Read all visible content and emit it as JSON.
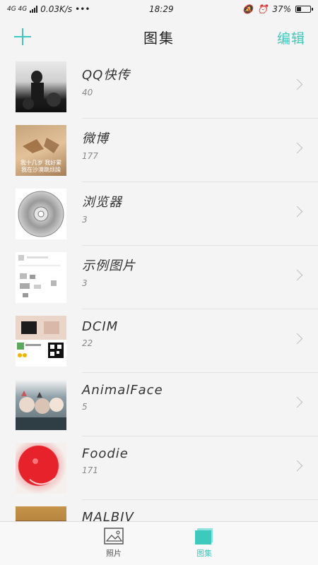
{
  "status_bar": {
    "network": "4G 4G",
    "speed": "0.03K/s",
    "dots": "•••",
    "time": "18:29",
    "battery": "37%",
    "battery_level": 0.37
  },
  "header": {
    "title": "图集",
    "edit_label": "编辑",
    "add_icon": "plus-icon",
    "accent_color": "#3ec9bd"
  },
  "albums": [
    {
      "name": "QQ快传",
      "count": "40"
    },
    {
      "name": "微博",
      "count": "177",
      "caption1": "我十几岁 我好累",
      "caption2": "我在沙漠跳烦躁"
    },
    {
      "name": "浏览器",
      "count": "3"
    },
    {
      "name": "示例图片",
      "count": "3"
    },
    {
      "name": "DCIM",
      "count": "22"
    },
    {
      "name": "AnimalFace",
      "count": "5"
    },
    {
      "name": "Foodie",
      "count": "171"
    },
    {
      "name": "MALBIV",
      "count": ""
    }
  ],
  "bottom_nav": {
    "photos_label": "照片",
    "albums_label": "图集"
  }
}
